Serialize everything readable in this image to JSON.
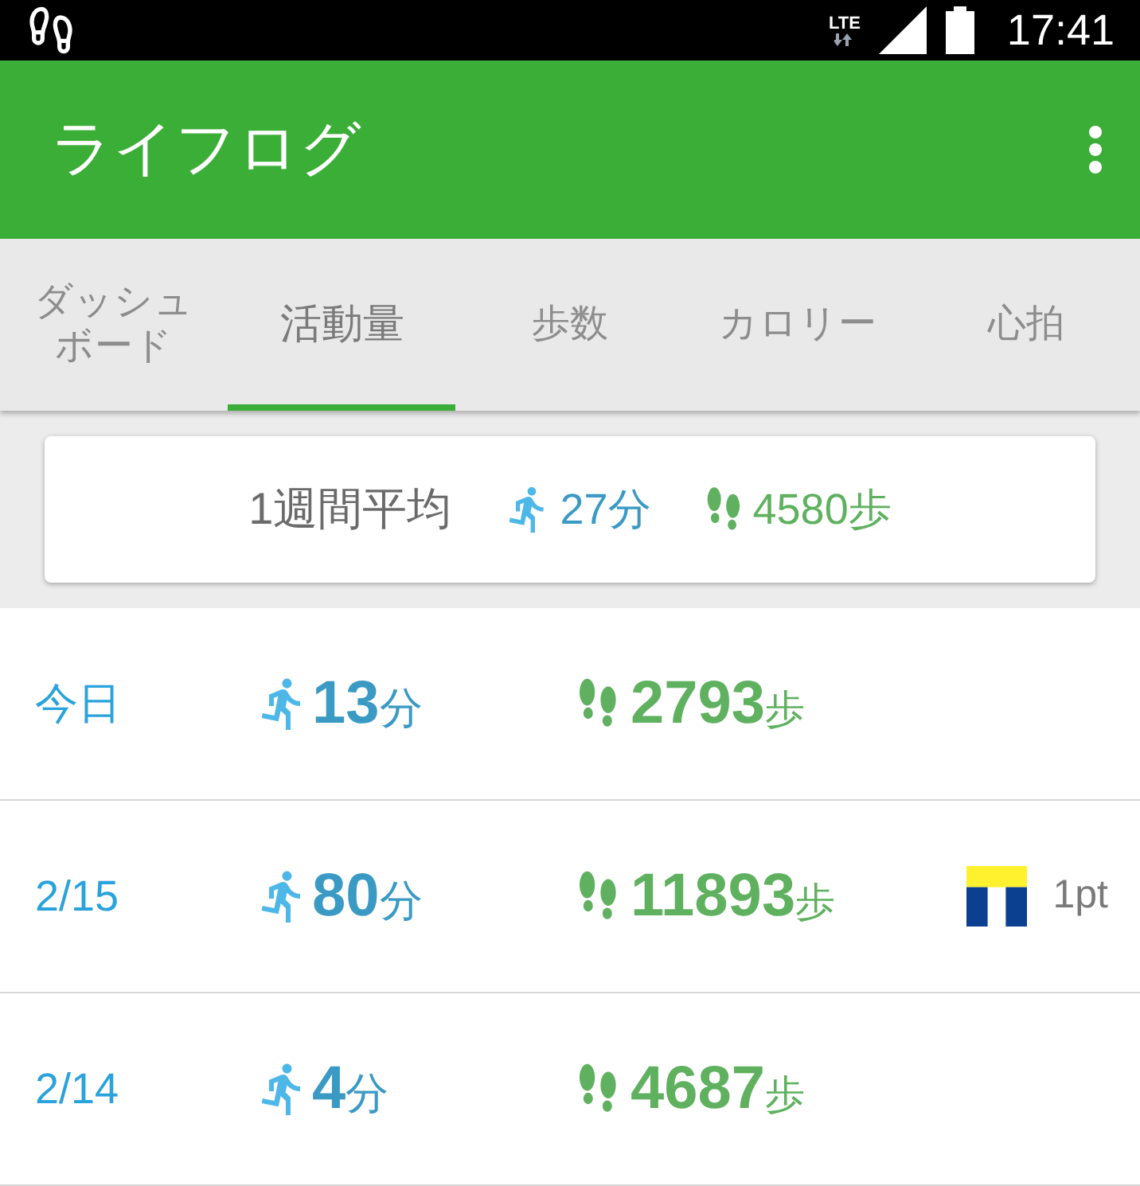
{
  "status_bar": {
    "network": "LTE",
    "time": "17:41"
  },
  "app_bar": {
    "title": "ライフログ"
  },
  "tabs": [
    {
      "label": "ダッシュボード",
      "selected": false
    },
    {
      "label": "活動量",
      "selected": true
    },
    {
      "label": "歩数",
      "selected": false
    },
    {
      "label": "カロリー",
      "selected": false
    },
    {
      "label": "心拍",
      "selected": false
    }
  ],
  "weekly_average": {
    "label": "1週間平均",
    "minutes": "27分",
    "steps": "4580歩"
  },
  "days": [
    {
      "date": "今日",
      "minutes": "13",
      "minutes_unit": "分",
      "steps": "2793",
      "steps_unit": "歩"
    },
    {
      "date": "2/15",
      "minutes": "80",
      "minutes_unit": "分",
      "steps": "11893",
      "steps_unit": "歩",
      "points": "1pt"
    },
    {
      "date": "2/14",
      "minutes": "4",
      "minutes_unit": "分",
      "steps": "4687",
      "steps_unit": "歩"
    }
  ]
}
